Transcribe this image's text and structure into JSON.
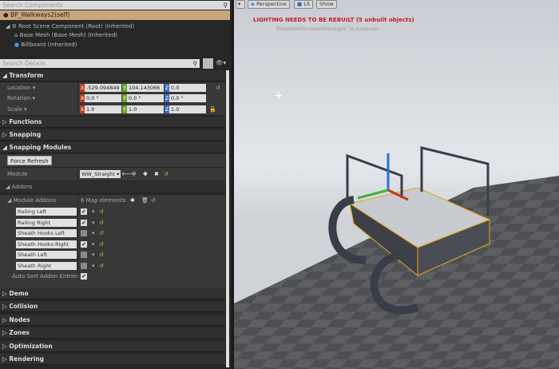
{
  "components": {
    "search_placeholder": "Search Components",
    "self": "BP_Walkways2(self)",
    "tree": [
      "Root Scene Component (Root) (Inherited)",
      "Base Mesh (Base Mesh) (Inherited)",
      "Billboard (Inherited)"
    ]
  },
  "details": {
    "search_placeholder": "Search Details",
    "transform": {
      "label": "Transform",
      "rows": [
        {
          "label": "Location",
          "x": "-529.094849",
          "y": "104.143066",
          "z": "0.0"
        },
        {
          "label": "Rotation",
          "x": "0.0 °",
          "y": "0.0 °",
          "z": "0.0 °"
        },
        {
          "label": "Scale",
          "x": "1.0",
          "y": "1.0",
          "z": "1.0"
        }
      ]
    },
    "functions": "Functions",
    "snapping": "Snapping",
    "snapping_modules": "Snapping Modules",
    "force_refresh": "Force Refresh",
    "module_label": "Module",
    "module_value": "WW_Straight",
    "addons": "Addons",
    "module_addons": "Module Addons",
    "map_elements": "6 Map elements",
    "addon_items": [
      {
        "name": "Railing Left",
        "checked": true
      },
      {
        "name": "Railing Right",
        "checked": true
      },
      {
        "name": "Sheath Hooks Left",
        "checked": false
      },
      {
        "name": "Sheath Hooks Right",
        "checked": true
      },
      {
        "name": "Sheath Left",
        "checked": false
      },
      {
        "name": "Sheath Right",
        "checked": false
      }
    ],
    "auto_sort": "Auto Sort Addon Entries",
    "auto_sort_checked": true,
    "categories": [
      "Demo",
      "Collision",
      "Nodes",
      "Zones",
      "Optimization",
      "Rendering"
    ]
  },
  "viewport": {
    "perspective": "Perspective",
    "lit": "Lit",
    "show": "Show",
    "warning": "LIGHTING NEEDS TO BE REBUILT (5 unbuilt objects)",
    "suppress": "'DisableAllScreenMessages' to suppress"
  },
  "colors": {
    "selected_row": "#c8a57a",
    "warning": "#c4202a",
    "x_axis": "#c23b22",
    "y_axis": "#6aa82a",
    "z_axis": "#3a6fc4",
    "selection_outline": "#e8a317"
  }
}
